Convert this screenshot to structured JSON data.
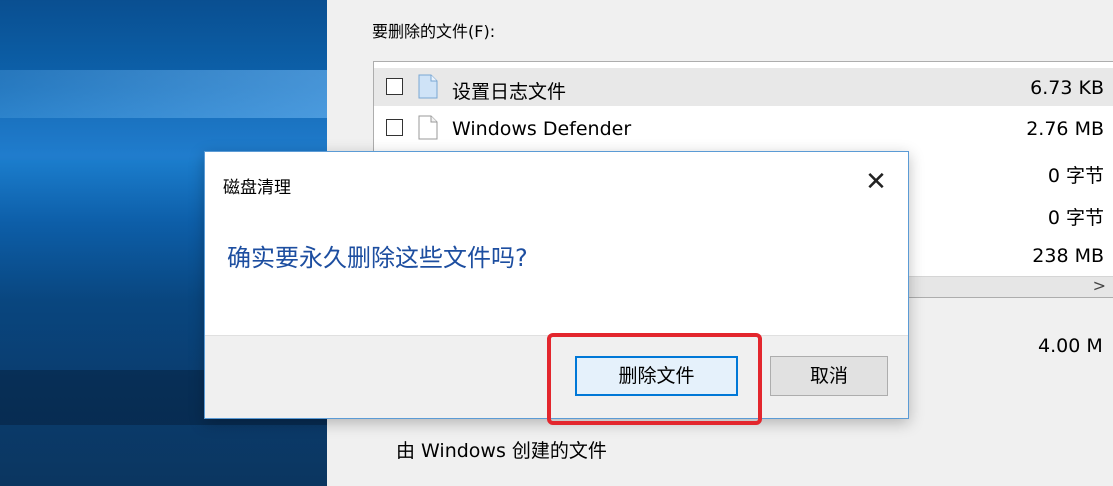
{
  "panel": {
    "files_label": "要删除的文件(F):",
    "files": [
      {
        "name": "设置日志文件",
        "size": "6.73 KB",
        "selected": true,
        "icon": "log-file-icon"
      },
      {
        "name": "Windows Defender",
        "size": "2.76 MB",
        "selected": false,
        "icon": "file-icon"
      },
      {
        "name": "",
        "size": "0 字节",
        "selected": false,
        "icon": ""
      },
      {
        "name": "",
        "size": "0 字节",
        "selected": false,
        "icon": ""
      },
      {
        "name": "",
        "size": "238 MB",
        "selected": false,
        "icon": ""
      }
    ],
    "scroll_arrow": ">",
    "total_size": "4.00 M",
    "description": "由 Windows 创建的文件"
  },
  "dialog": {
    "title": "磁盘清理",
    "close_glyph": "✕",
    "message": "确实要永久删除这些文件吗?",
    "delete_button": "删除文件",
    "cancel_button": "取消"
  },
  "colors": {
    "message": "#1d4ea0",
    "focus_border": "#0078d7",
    "highlight": "#e3262d"
  }
}
